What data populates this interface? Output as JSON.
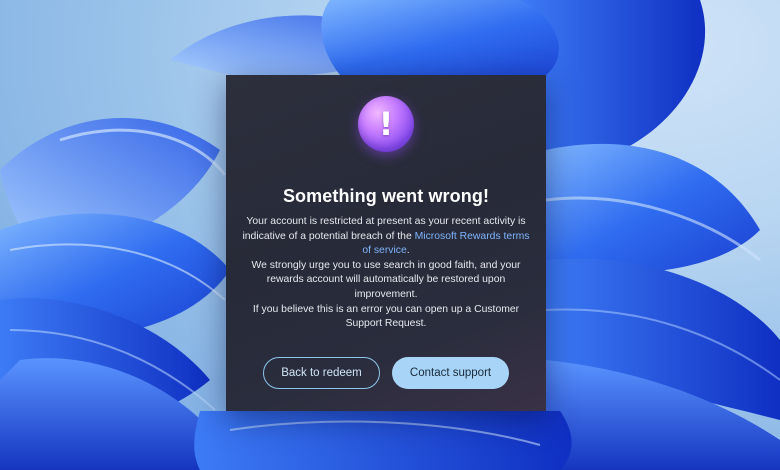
{
  "dialog": {
    "icon": "exclamation-alert-icon",
    "icon_glyph": "!",
    "title": "Something went wrong!",
    "paragraph1_before_link": "Your account is restricted at present as your recent activity is indicative of a potential breach of the ",
    "paragraph1_link": "Microsoft Rewards terms of service",
    "paragraph1_after_link": ".",
    "paragraph2": "We strongly urge you to use search in good faith, and your rewards account will automatically be restored upon improvement.",
    "paragraph3": "If you believe this is an error you can open up a Customer Support Request.",
    "back_button": "Back to redeem",
    "contact_button": "Contact support"
  },
  "colors": {
    "dialog_bg": "#2b2d3b",
    "link": "#7fb4ff",
    "primary_button": "#a8d5f7",
    "secondary_button_border": "#8ec5ea",
    "icon_accent": "#c77dff"
  }
}
